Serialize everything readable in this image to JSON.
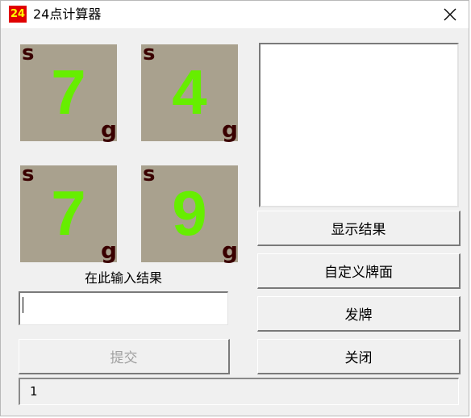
{
  "window": {
    "icon_text": "24",
    "title": "24点计算器"
  },
  "cards": [
    {
      "value": "7",
      "suit_top": "s",
      "suit_bottom": "g"
    },
    {
      "value": "4",
      "suit_top": "s",
      "suit_bottom": "g"
    },
    {
      "value": "7",
      "suit_top": "s",
      "suit_bottom": "g"
    },
    {
      "value": "9",
      "suit_top": "s",
      "suit_bottom": "g"
    }
  ],
  "input": {
    "label": "在此输入结果",
    "value": ""
  },
  "buttons": {
    "submit": "提交",
    "show_result": "显示结果",
    "custom_cards": "自定义牌面",
    "deal": "发牌",
    "close": "关闭"
  },
  "status": {
    "text": "1"
  },
  "colors": {
    "card_bg": "#a9a18e",
    "card_number": "#66ee00",
    "suit": "#3a0000",
    "icon_bg": "#e00000",
    "icon_text": "#ffff00"
  }
}
